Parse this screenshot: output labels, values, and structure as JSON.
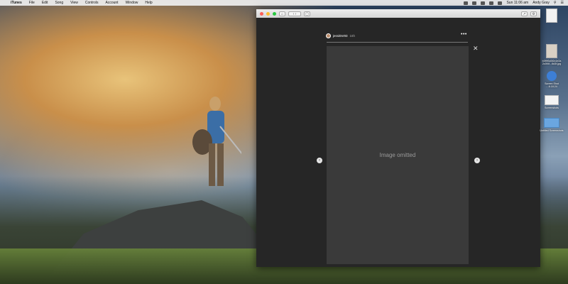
{
  "menubar": {
    "apple": "",
    "app": "iTunes",
    "menus": [
      "File",
      "Edit",
      "Song",
      "View",
      "Controls",
      "Account",
      "Window",
      "Help"
    ],
    "clock": "Sun 11:06 am",
    "user": "Andy Gray"
  },
  "window": {
    "username": "jessi0nr93",
    "time": "16h",
    "more": "•••",
    "close": "✕",
    "nav_prev": "‹",
    "nav_next": "›",
    "home_icon": "home-icon",
    "story_note": "Image omitted"
  },
  "desktop_icons": [
    {
      "label": "",
      "icon": "document-icon"
    },
    {
      "label": "b3f9f3d3f2c1e2a\n2c0f4f…6d3f.jpg",
      "icon": "image-icon"
    },
    {
      "label": "Screen Shot\n…6.18.24",
      "icon": "screenshot-icon"
    },
    {
      "label": "Screenshots",
      "icon": "folder-icon"
    },
    {
      "label": "Untitled Screenshots",
      "icon": "folder-icon"
    }
  ]
}
